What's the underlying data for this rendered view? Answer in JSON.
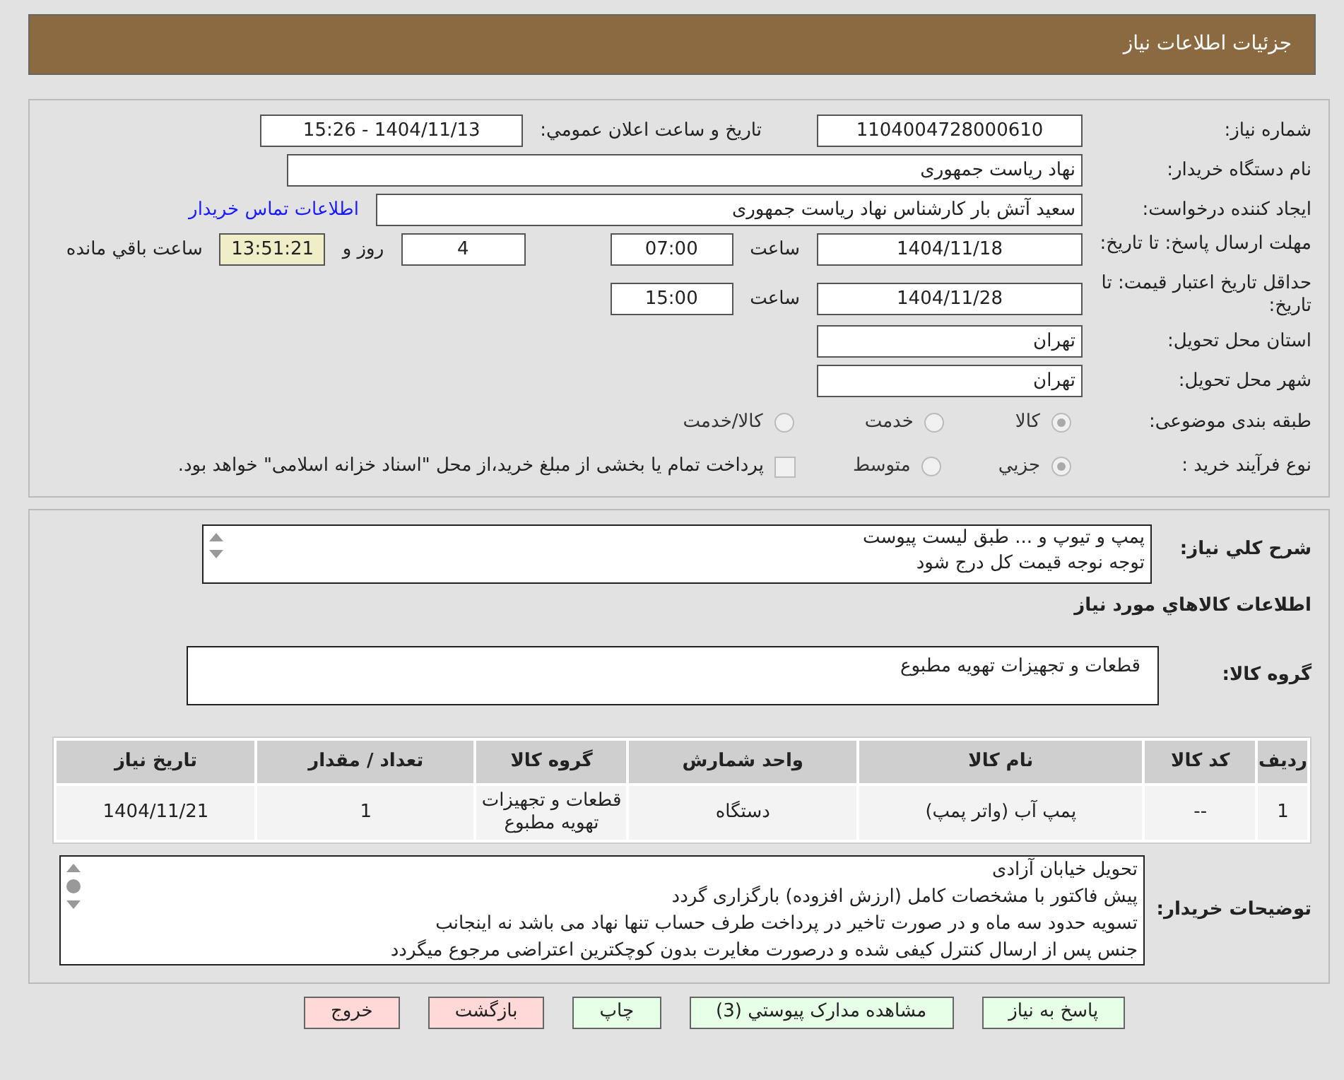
{
  "header": {
    "title": "جزئیات اطلاعات نیاز"
  },
  "need_number": {
    "label": "شماره نیاز:",
    "value": "1104004728000610"
  },
  "announce": {
    "label": "تاریخ و ساعت اعلان عمومي:",
    "value": "1404/11/13 - 15:26"
  },
  "buyer_org": {
    "label": "نام دستگاه خریدار:",
    "value": "نهاد ریاست جمهوری"
  },
  "requester": {
    "label": "ایجاد کننده درخواست:",
    "value": "سعید آتش بار کارشناس نهاد ریاست جمهوری",
    "link": "اطلاعات تماس خریدار"
  },
  "deadline": {
    "label": "مهلت ارسال پاسخ: تا تاریخ:",
    "date": "1404/11/18",
    "time_label": "ساعت",
    "time": "07:00",
    "days": "4",
    "days_label": "روز و",
    "remaining": "13:51:21",
    "remaining_label": "ساعت باقي مانده"
  },
  "validity": {
    "label": "حداقل تاریخ اعتبار قیمت: تا تاریخ:",
    "date": "1404/11/28",
    "time_label": "ساعت",
    "time": "15:00"
  },
  "province": {
    "label": "استان محل تحویل:",
    "value": "تهران"
  },
  "city": {
    "label": "شهر محل تحویل:",
    "value": "تهران"
  },
  "category": {
    "label": "طبقه بندی موضوعی:",
    "options": [
      {
        "label": "کالا",
        "selected": true
      },
      {
        "label": "خدمت",
        "selected": false
      },
      {
        "label": "کالا/خدمت",
        "selected": false
      }
    ]
  },
  "process": {
    "label": "نوع فرآیند خرید :",
    "options": [
      {
        "label": "جزيي",
        "selected": true
      },
      {
        "label": "متوسط",
        "selected": false
      }
    ],
    "treasury": {
      "checked": false,
      "label": "پرداخت تمام یا بخشی از مبلغ خرید،از محل \"اسناد خزانه اسلامی\" خواهد بود."
    }
  },
  "description": {
    "label": "شرح کلي نیاز:",
    "lines": [
      "پمپ و تیوپ و ... طبق لیست پیوست",
      "توجه نوجه قیمت کل درج شود"
    ]
  },
  "goods_title": "اطلاعات کالاهاي مورد نیاز",
  "goods_group": {
    "label": "گروه کالا:",
    "value": "قطعات و تجهیزات تهویه مطبوع"
  },
  "table": {
    "columns": [
      "ردیف",
      "کد کالا",
      "نام کالا",
      "واحد شمارش",
      "گروه کالا",
      "تعداد / مقدار",
      "تاریخ نیاز"
    ],
    "rows": [
      [
        "1",
        "--",
        "پمپ آب (واتر پمپ)",
        "دستگاه",
        "قطعات و تجهیزات تهویه مطبوع",
        "1",
        "1404/11/21"
      ]
    ]
  },
  "notes": {
    "label": "توضیحات خریدار:",
    "lines": [
      "تحویل خیابان آزادی",
      "پیش فاکتور با مشخصات کامل (ارزش افزوده) بارگزاری گردد",
      "تسویه حدود سه ماه و در صورت تاخیر در پرداخت طرف حساب تنها نهاد می باشد نه اینجانب",
      "جنس پس از ارسال کنترل کیفی شده و درصورت مغایرت بدون کوچکترین اعتراضی مرجوع میگردد"
    ]
  },
  "buttons": [
    {
      "label": "پاسخ به نیاز",
      "kind": "action"
    },
    {
      "label": "مشاهده مدارک پیوستي (3)",
      "kind": "action"
    },
    {
      "label": "چاپ",
      "kind": "action"
    },
    {
      "label": "بازگشت",
      "kind": "exit"
    },
    {
      "label": "خروج",
      "kind": "exit"
    }
  ]
}
